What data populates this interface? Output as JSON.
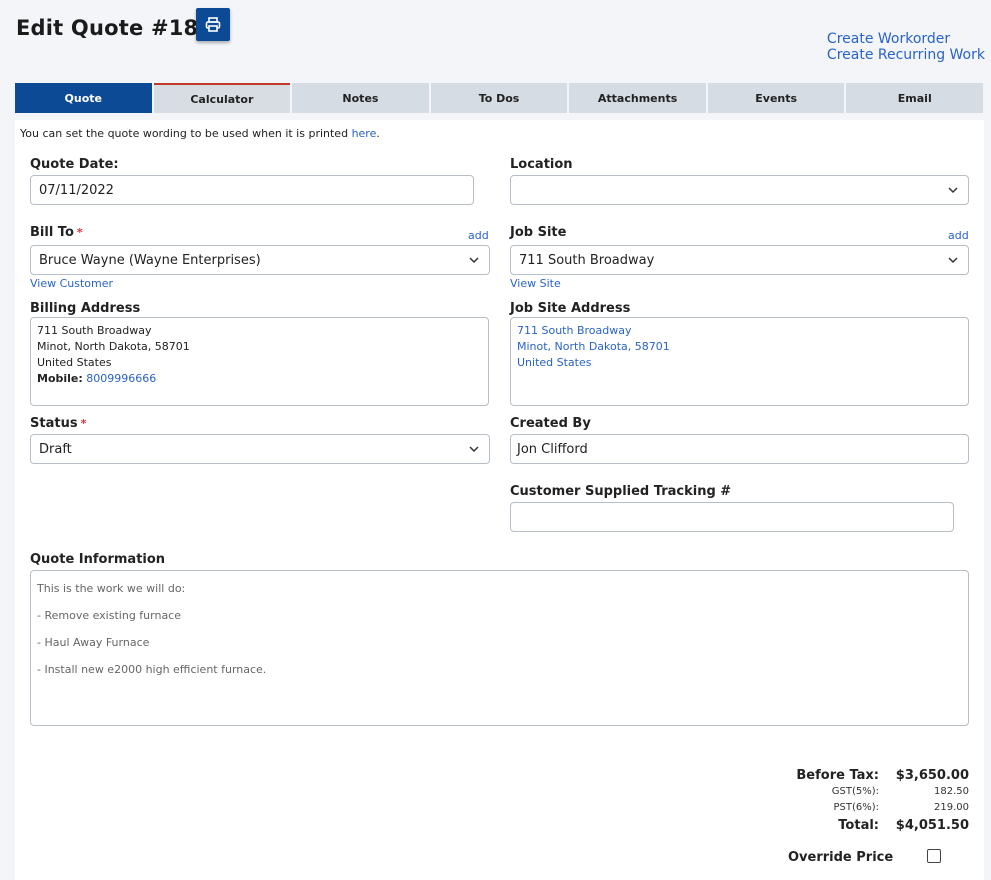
{
  "page": {
    "title": "Edit Quote #1828",
    "print_icon": "printer-icon"
  },
  "header_links": {
    "create_workorder": "Create Workorder",
    "create_recurring_work": "Create Recurring Work"
  },
  "tabs": [
    {
      "label": "Quote",
      "active": true
    },
    {
      "label": "Calculator",
      "active": false
    },
    {
      "label": "Notes",
      "active": false
    },
    {
      "label": "To Dos",
      "active": false
    },
    {
      "label": "Attachments",
      "active": false
    },
    {
      "label": "Events",
      "active": false
    },
    {
      "label": "Email",
      "active": false
    }
  ],
  "notice": {
    "text": "You can set the quote wording to be used when it is printed ",
    "link": "here",
    "suffix": "."
  },
  "form": {
    "quote_date": {
      "label": "Quote Date:",
      "value": "07/11/2022"
    },
    "location": {
      "label": "Location",
      "value": ""
    },
    "bill_to": {
      "label": "Bill To",
      "required_mark": "*",
      "add_link": "add",
      "value": "Bruce Wayne (Wayne Enterprises)",
      "view_link": "View Customer"
    },
    "job_site": {
      "label": "Job Site",
      "add_link": "add",
      "value": "711 South Broadway",
      "view_link": "View Site"
    },
    "billing_address": {
      "label": "Billing Address",
      "line1": "711 South Broadway",
      "line2": "Minot, North Dakota, 58701",
      "line3": "United States",
      "mobile_label": "Mobile:",
      "mobile_value": "8009996666"
    },
    "job_site_address": {
      "label": "Job Site Address",
      "line1": "711 South Broadway",
      "line2": "Minot, North Dakota, 58701",
      "line3": "United States"
    },
    "status": {
      "label": "Status",
      "required_mark": "*",
      "value": "Draft"
    },
    "created_by": {
      "label": "Created By",
      "value": "Jon Clifford"
    },
    "tracking": {
      "label": "Customer Supplied Tracking #",
      "value": ""
    },
    "quote_information": {
      "label": "Quote Information",
      "lines": [
        "This is the work we will do:",
        "- Remove existing furnace",
        "- Haul Away Furnace",
        "- Install new e2000 high efficient furnace."
      ]
    }
  },
  "totals": {
    "before_tax_label": "Before Tax:",
    "before_tax_value": "$3,650.00",
    "gst_label": "GST(5%):",
    "gst_value": "182.50",
    "pst_label": "PST(6%):",
    "pst_value": "219.00",
    "total_label": "Total:",
    "total_value": "$4,051.50",
    "override_label": "Override Price",
    "override_checked": false
  },
  "colors": {
    "primary": "#0d4a96",
    "link": "#2a63c8",
    "required": "#dd3333"
  }
}
